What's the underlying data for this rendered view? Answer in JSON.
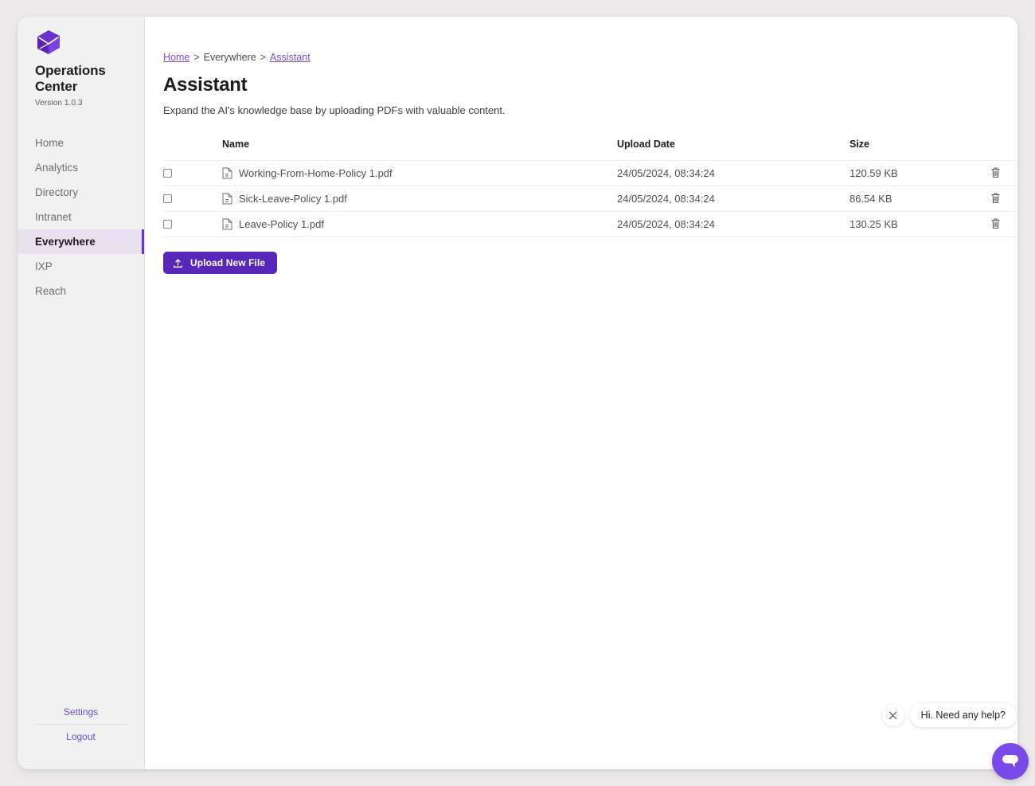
{
  "sidebar": {
    "logo_icon": "cube-envelope-logo",
    "brand_name": "Operations Center",
    "version": "Version 1.0.3",
    "items": [
      {
        "label": "Home",
        "active": false
      },
      {
        "label": "Analytics",
        "active": false
      },
      {
        "label": "Directory",
        "active": false
      },
      {
        "label": "Intranet",
        "active": false
      },
      {
        "label": "Everywhere",
        "active": true
      },
      {
        "label": "IXP",
        "active": false
      },
      {
        "label": "Reach",
        "active": false
      }
    ],
    "footer": {
      "settings_label": "Settings",
      "logout_label": "Logout"
    }
  },
  "breadcrumb": {
    "home_label": "Home",
    "separator": ">",
    "section_label": "Everywhere",
    "current_label": "Assistant"
  },
  "page": {
    "title": "Assistant",
    "subtitle": "Expand the AI's knowledge base by uploading PDFs with valuable content."
  },
  "table": {
    "headers": {
      "select": "",
      "name": "Name",
      "upload_date": "Upload Date",
      "size": "Size",
      "actions": ""
    },
    "rows": [
      {
        "name": "Working-From-Home-Policy 1.pdf",
        "upload_date": "24/05/2024, 08:34:24",
        "size": "120.59 KB",
        "file_icon": "pdf-file-icon",
        "delete_icon": "trash-icon",
        "checked": false
      },
      {
        "name": "Sick-Leave-Policy 1.pdf",
        "upload_date": "24/05/2024, 08:34:24",
        "size": "86.54 KB",
        "file_icon": "pdf-file-icon",
        "delete_icon": "trash-icon",
        "checked": false
      },
      {
        "name": "Leave-Policy 1.pdf",
        "upload_date": "24/05/2024, 08:34:24",
        "size": "130.25 KB",
        "file_icon": "pdf-file-icon",
        "delete_icon": "trash-icon",
        "checked": false
      }
    ]
  },
  "upload": {
    "label": "Upload New File",
    "icon": "upload-icon"
  },
  "chat_widget": {
    "message": "Hi. Need any help?",
    "close_icon": "close-icon",
    "launcher_icon": "chat-bubble-icon"
  },
  "colors": {
    "accent_purple": "#5627b9",
    "link_purple": "#7a4fd0",
    "nav_active_bg": "#e9e0ef",
    "nav_active_bar": "#6c31cc",
    "chat_purple": "#7a4ae8",
    "page_bg": "#eceaea",
    "sidebar_bg": "#f1f1f1"
  }
}
